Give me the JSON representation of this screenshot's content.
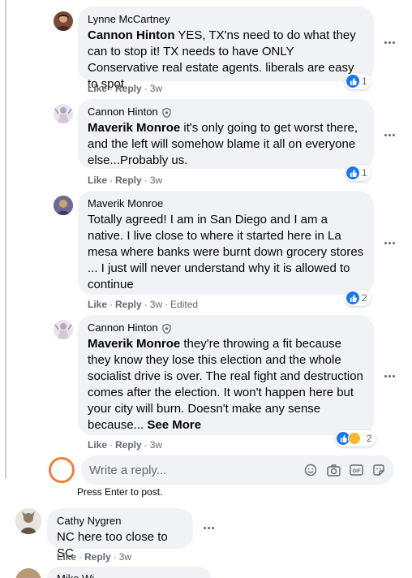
{
  "comments": [
    {
      "author": "Lynne McCartney",
      "mention": "Cannon Hinton",
      "text": " YES, TX'ns need to do what they can to stop it! TX needs to have ONLY Conservative real estate agents. liberals are easy to spot.",
      "like": "Like",
      "reply": "Reply",
      "time": "3w",
      "reaction_count": "1"
    },
    {
      "author": "Cannon Hinton",
      "mention": "Maverik Monroe",
      "text": " it's only going to get worst there, and the left will somehow blame it all on everyone else...Probably us.",
      "like": "Like",
      "reply": "Reply",
      "time": "3w",
      "reaction_count": "1"
    },
    {
      "author": "Maverik Monroe",
      "text": "Totally agreed! I am in San Diego and I am a native. I live close to where it started here in La mesa where banks were burnt down grocery stores ... I just will never understand why it is allowed to continue",
      "like": "Like",
      "reply": "Reply",
      "time": "3w",
      "edited": "Edited",
      "reaction_count": "2"
    },
    {
      "author": "Cannon Hinton",
      "mention": "Maverik Monroe",
      "text": " they're throwing a fit because they know they lose this election and the whole socialist drive is over. The real fight and destruction comes after the election. It won't happen here but your city will burn. Doesn't make any sense because...",
      "see_more": "See More",
      "like": "Like",
      "reply": "Reply",
      "time": "3w",
      "reaction_count": "2"
    }
  ],
  "reply_box": {
    "placeholder": "Write a reply...",
    "hint": "Press Enter to post."
  },
  "bottom_comment": {
    "author": "Cathy Nygren",
    "text": "NC here too close to SC",
    "like": "Like",
    "reply": "Reply",
    "time": "3w"
  },
  "partial_comment": {
    "author": "Mike Wi"
  },
  "colors": {
    "bubble": "#f0f2f5",
    "like_blue": "#1877f2",
    "muted": "#65676b",
    "avatar_ring": "#f07f3c"
  }
}
